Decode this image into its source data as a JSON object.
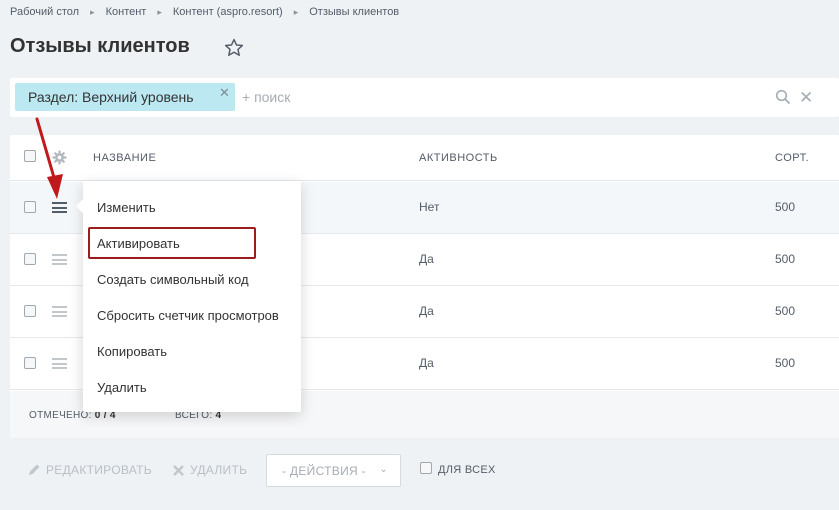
{
  "breadcrumb": [
    "Рабочий стол",
    "Контент",
    "Контент (aspro.resort)",
    "Отзывы клиентов"
  ],
  "page": {
    "title": "Отзывы клиентов"
  },
  "filter": {
    "chip_label": "Раздел: Верхний уровень",
    "search_placeholder": "+ поиск"
  },
  "grid": {
    "headers": {
      "name": "НАЗВАНИЕ",
      "active": "АКТИВНОСТЬ",
      "sort": "СОРТ."
    },
    "rows": [
      {
        "active": "Нет",
        "sort": "500"
      },
      {
        "active": "Да",
        "sort": "500"
      },
      {
        "active": "Да",
        "sort": "500"
      },
      {
        "active": "Да",
        "sort": "500"
      }
    ],
    "footer": {
      "checked_label": "ОТМЕЧЕНО:",
      "checked_value": "0 / 4",
      "total_label": "ВСЕГО:",
      "total_value": "4"
    }
  },
  "action_panel": {
    "edit": "РЕДАКТИРОВАТЬ",
    "delete": "УДАЛИТЬ",
    "actions_select": "- ДЕЙСТВИЯ -",
    "for_all": "ДЛЯ ВСЕХ"
  },
  "context_menu": {
    "items": [
      "Изменить",
      "Активировать",
      "Создать символьный код",
      "Сбросить счетчик просмотров",
      "Копировать",
      "Удалить"
    ]
  },
  "icons": {
    "star": "star-icon",
    "search": "search-icon",
    "settings": "gear-icon",
    "row_menu": "hamburger-icon",
    "edit": "pencil-icon",
    "delete": "x-icon"
  },
  "colors": {
    "chip": "#bce8f1",
    "highlight": "#9b1c1c",
    "arrow": "#c0191d"
  }
}
